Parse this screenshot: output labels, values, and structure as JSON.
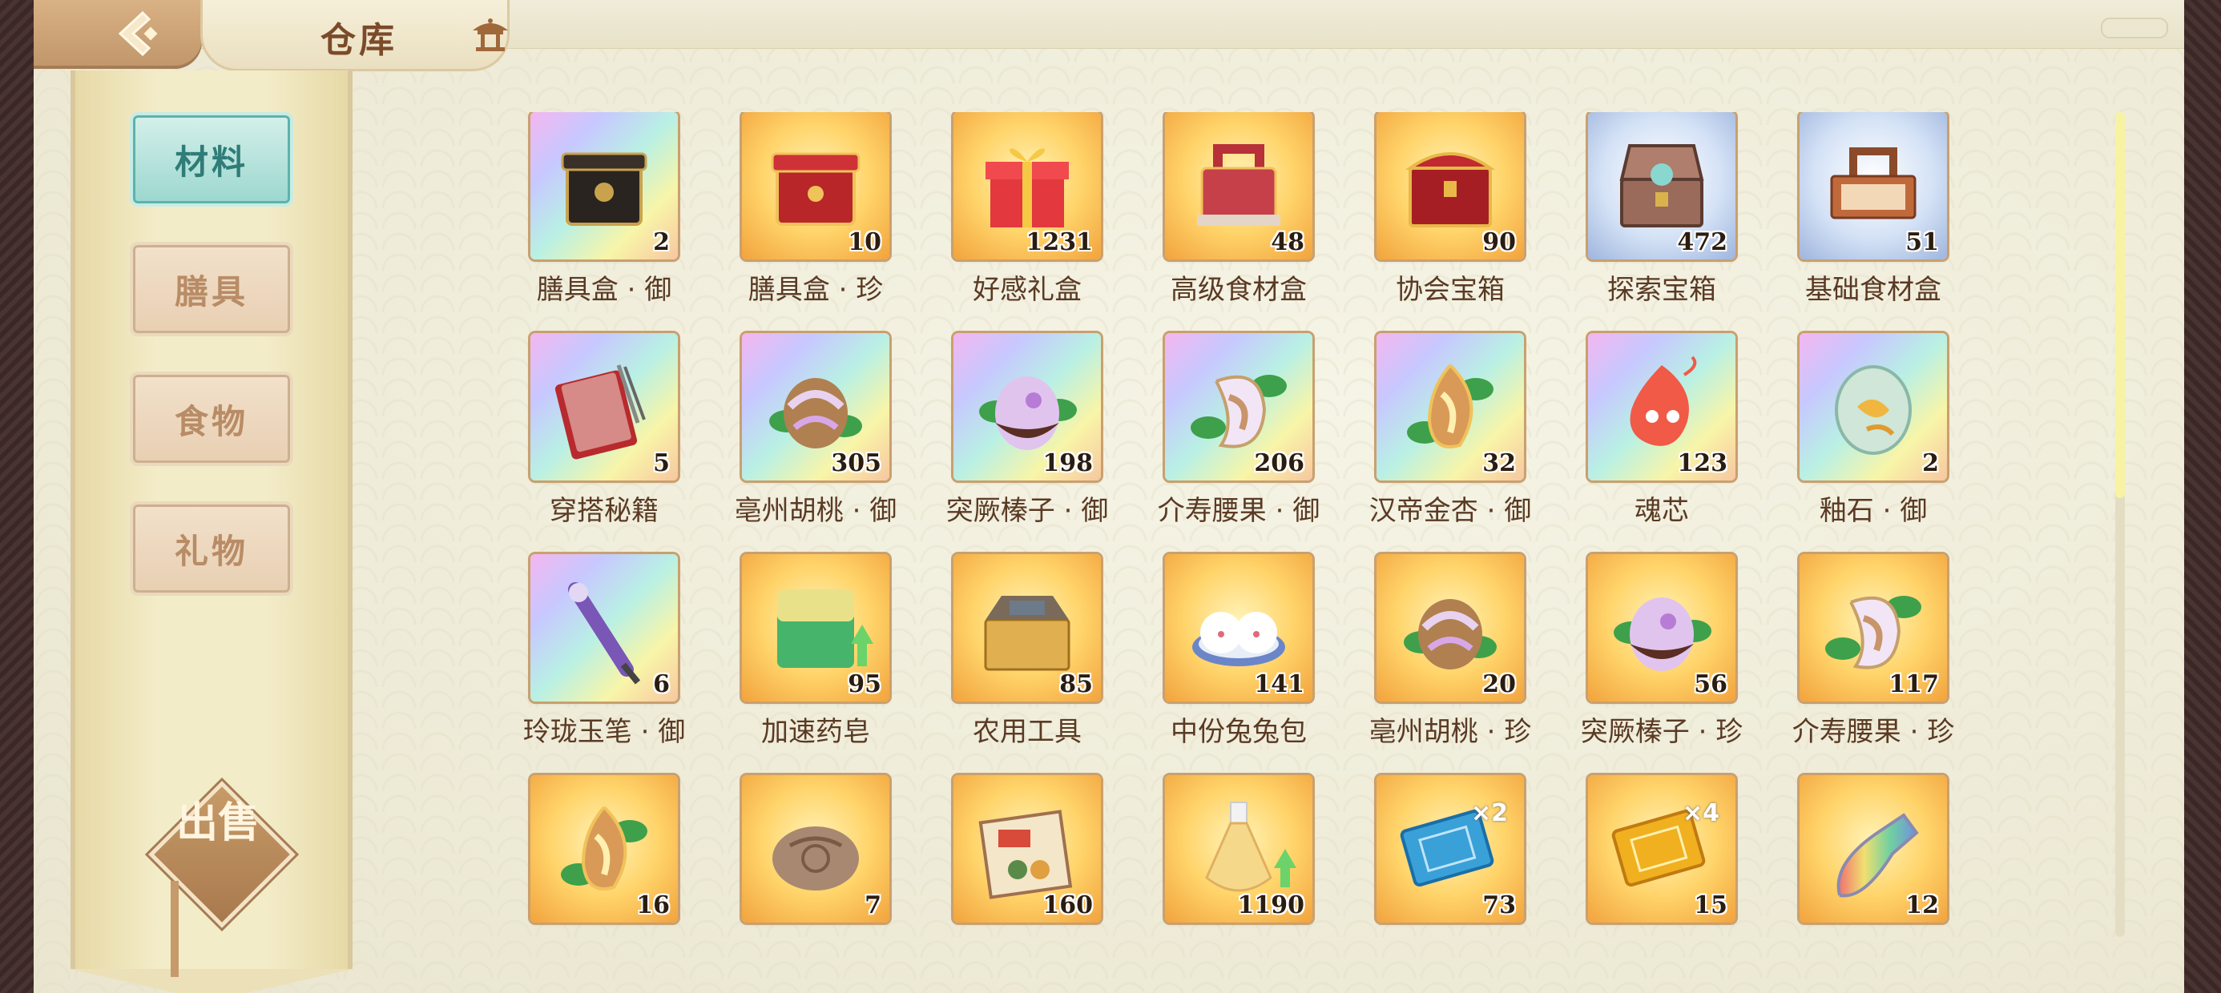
{
  "header": {
    "title": "仓库"
  },
  "sidebar": {
    "categories": [
      {
        "label": "材料",
        "active": true
      },
      {
        "label": "膳具",
        "active": false
      },
      {
        "label": "食物",
        "active": false
      },
      {
        "label": "礼物",
        "active": false
      }
    ],
    "sell_label": "出售"
  },
  "items": [
    {
      "name": "膳具盒 · 御",
      "count": "2",
      "icon": "black-lacquer-box-icon",
      "frame": "rainbow"
    },
    {
      "name": "膳具盒 · 珍",
      "count": "10",
      "icon": "red-lacquer-box-icon",
      "frame": "gold"
    },
    {
      "name": "好感礼盒",
      "count": "1231",
      "icon": "gift-box-icon",
      "frame": "gold"
    },
    {
      "name": "高级食材盒",
      "count": "48",
      "icon": "red-basket-icon",
      "frame": "gold"
    },
    {
      "name": "协会宝箱",
      "count": "90",
      "icon": "red-chest-icon",
      "frame": "gold"
    },
    {
      "name": "探索宝箱",
      "count": "472",
      "icon": "open-chest-icon",
      "frame": "blue"
    },
    {
      "name": "基础食材盒",
      "count": "51",
      "icon": "wood-basket-icon",
      "frame": "blue"
    },
    {
      "name": "穿搭秘籍",
      "count": "5",
      "icon": "book-icon",
      "frame": "rainbow"
    },
    {
      "name": "亳州胡桃 · 御",
      "count": "305",
      "icon": "walnut-icon",
      "frame": "rainbow"
    },
    {
      "name": "突厥榛子 · 御",
      "count": "198",
      "icon": "hazelnut-icon",
      "frame": "rainbow"
    },
    {
      "name": "介寿腰果 · 御",
      "count": "206",
      "icon": "cashew-icon",
      "frame": "rainbow"
    },
    {
      "name": "汉帝金杏 · 御",
      "count": "32",
      "icon": "apricot-icon",
      "frame": "rainbow"
    },
    {
      "name": "魂芯",
      "count": "123",
      "icon": "flame-spirit-icon",
      "frame": "rainbow"
    },
    {
      "name": "釉石 · 御",
      "count": "2",
      "icon": "glaze-stone-icon",
      "frame": "rainbow"
    },
    {
      "name": "玲珑玉笔 · 御",
      "count": "6",
      "icon": "jade-brush-icon",
      "frame": "rainbow"
    },
    {
      "name": "加速药皂",
      "count": "95",
      "icon": "soap-icon",
      "frame": "gold"
    },
    {
      "name": "农用工具",
      "count": "85",
      "icon": "toolbox-icon",
      "frame": "gold"
    },
    {
      "name": "中份兔兔包",
      "count": "141",
      "icon": "bunny-bun-icon",
      "frame": "gold"
    },
    {
      "name": "亳州胡桃 · 珍",
      "count": "20",
      "icon": "walnut-icon",
      "frame": "gold"
    },
    {
      "name": "突厥榛子 · 珍",
      "count": "56",
      "icon": "hazelnut-icon",
      "frame": "gold"
    },
    {
      "name": "介寿腰果 · 珍",
      "count": "117",
      "icon": "cashew-icon",
      "frame": "gold"
    },
    {
      "name": "",
      "count": "16",
      "icon": "apricot-icon",
      "frame": "gold"
    },
    {
      "name": "",
      "count": "7",
      "icon": "sack-icon",
      "frame": "gold"
    },
    {
      "name": "",
      "count": "160",
      "icon": "recipe-scroll-icon",
      "frame": "gold"
    },
    {
      "name": "",
      "count": "1190",
      "icon": "potion-icon",
      "frame": "gold"
    },
    {
      "name": "",
      "count": "73",
      "icon": "blue-ticket-icon",
      "frame": "gold"
    },
    {
      "name": "",
      "count": "15",
      "icon": "gold-ticket-icon",
      "frame": "gold"
    },
    {
      "name": "",
      "count": "12",
      "icon": "rainbow-vial-icon",
      "frame": "gold"
    }
  ],
  "ticket_multipliers": {
    "blue": "×2",
    "gold": "×4"
  },
  "colors": {
    "accent_teal": "#9bd7cf",
    "frame_brown": "#c9a06f",
    "text_brown": "#5a3a24"
  }
}
